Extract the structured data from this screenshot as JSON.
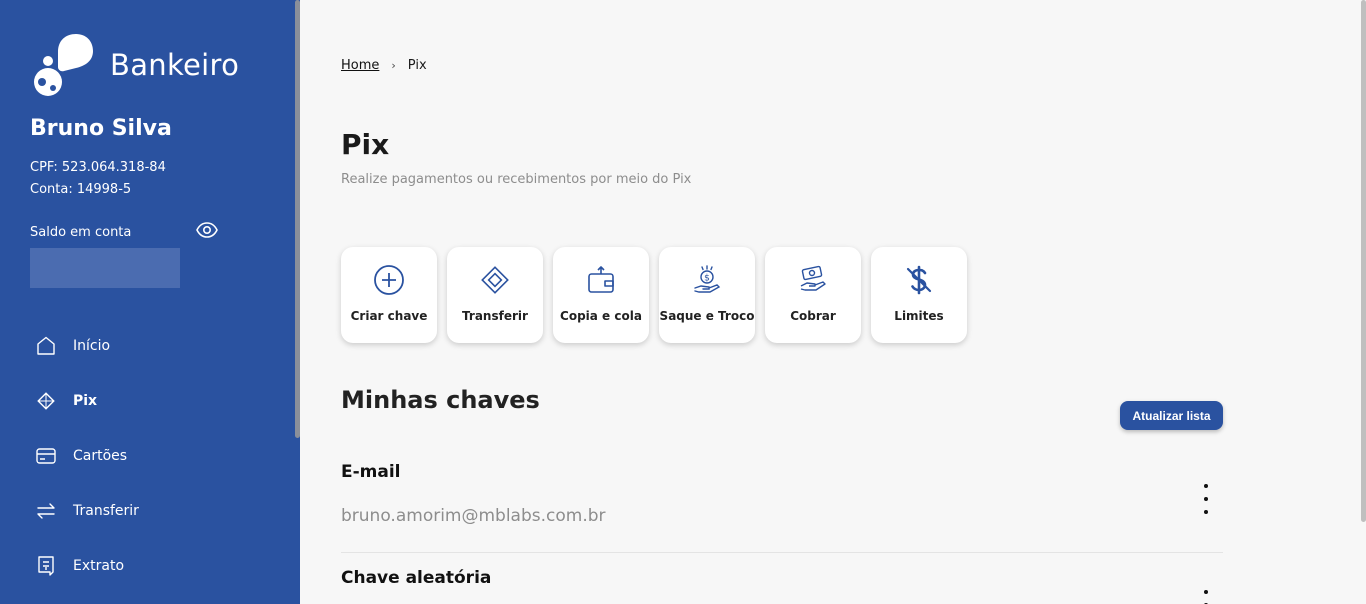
{
  "brand": {
    "name": "Bankeiro"
  },
  "user": {
    "name": "Bruno Silva",
    "cpf": "CPF: 523.064.318-84",
    "conta": "Conta: 14998-5",
    "balance_label": "Saldo em conta"
  },
  "nav": [
    {
      "label": "Início",
      "icon": "home-icon"
    },
    {
      "label": "Pix",
      "icon": "pix-icon",
      "active": true
    },
    {
      "label": "Cartões",
      "icon": "card-icon"
    },
    {
      "label": "Transferir",
      "icon": "transfer-icon"
    },
    {
      "label": "Extrato",
      "icon": "receipt-icon"
    }
  ],
  "breadcrumb": {
    "home": "Home",
    "current": "Pix"
  },
  "page": {
    "title": "Pix",
    "subtitle": "Realize pagamentos ou recebimentos por meio do Pix"
  },
  "actions": [
    {
      "label": "Criar chave",
      "icon": "plus-circle-icon"
    },
    {
      "label": "Transferir",
      "icon": "pix-icon"
    },
    {
      "label": "Copia e cola",
      "icon": "wallet-icon"
    },
    {
      "label": "Saque e Troco",
      "icon": "coin-hand-icon"
    },
    {
      "label": "Cobrar",
      "icon": "cash-hand-icon"
    },
    {
      "label": "Limites",
      "icon": "dollar-off-icon"
    }
  ],
  "keys": {
    "title": "Minhas chaves",
    "refresh_label": "Atualizar lista",
    "items": [
      {
        "type": "E-mail",
        "value": "bruno.amorim@mblabs.com.br"
      },
      {
        "type": "Chave aleatória",
        "value": ""
      }
    ]
  },
  "colors": {
    "primary": "#2a52a0",
    "background": "#f7f7f7"
  }
}
